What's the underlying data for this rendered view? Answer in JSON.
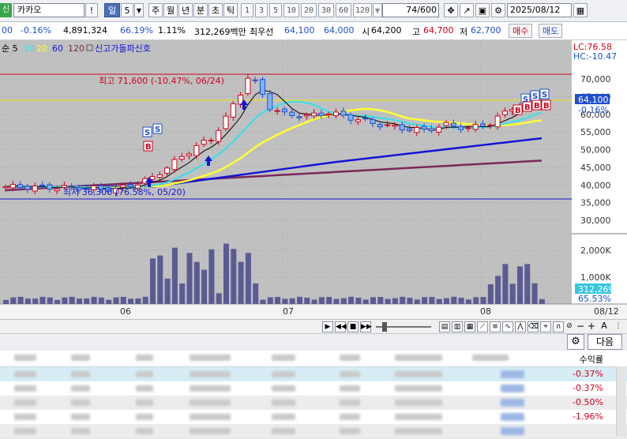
{
  "toolbar": {
    "stock_badge": "신",
    "stock_name": "카카오",
    "bang": "!",
    "period_selected": "일",
    "period_num": "5",
    "periods": [
      "주",
      "월",
      "년",
      "분",
      "초",
      "틱"
    ],
    "intervals": [
      "1",
      "3",
      "5",
      "10",
      "20",
      "30",
      "60",
      "120"
    ],
    "bars_value": "74",
    "bars_total": "/600",
    "date": "2025/08/12"
  },
  "quote": {
    "change_price": "00",
    "change_pct": "-0.16%",
    "volume": "4,891,324",
    "volume_ratio": "66.19%",
    "turnover": "1.11%",
    "amount": "312,269백만",
    "best_bid_label": "최우선",
    "best_bid": "64,100",
    "best_ask": "64,000",
    "open_label": "시",
    "open": "64,200",
    "high_label": "고",
    "high": "64,700",
    "low_label": "저",
    "low": "62,700",
    "buy_label": "매수",
    "sell_label": "매도"
  },
  "legend": {
    "ma_prefix": "순 5",
    "ma10": "10",
    "ma20": "20",
    "ma60": "60",
    "ma120": "120",
    "signal": "신고가돌파신호"
  },
  "annotations": {
    "high_note": "최고 71,600 (-10.47%, 06/24)",
    "low_note": "최저 36,300 (76.58%, 05/20)",
    "lc": "LC:76.58",
    "hc": "HC:-10.47",
    "current_price": "64,100",
    "current_pct": "-0.16%",
    "vol_current": "312,269",
    "vol_pct": "65.53%"
  },
  "chart_data": {
    "type": "candlestick",
    "price_axis": {
      "ticks": [
        "70,000",
        "65,000",
        "60,000",
        "55,000",
        "50,000",
        "45,000",
        "40,000",
        "35,000",
        "30,000"
      ]
    },
    "volume_axis": {
      "ticks": [
        "2,000K",
        "1,000K"
      ]
    },
    "date_axis": [
      "06",
      "07",
      "08",
      "08/12"
    ],
    "moving_averages": [
      "5",
      "10",
      "20",
      "60",
      "120"
    ]
  },
  "table": {
    "next_label": "다음",
    "col_return": "수익률",
    "returns": [
      "-0.37%",
      "-0.37%",
      "-0.50%",
      "-1.96%",
      ""
    ]
  },
  "colors": {
    "up": "#d0021b",
    "down": "#1f4fd1",
    "ma5": "#000000",
    "ma10": "#33e0f0",
    "ma20": "#ffff33",
    "ma60": "#1414d6",
    "ma120": "#7a2858"
  }
}
